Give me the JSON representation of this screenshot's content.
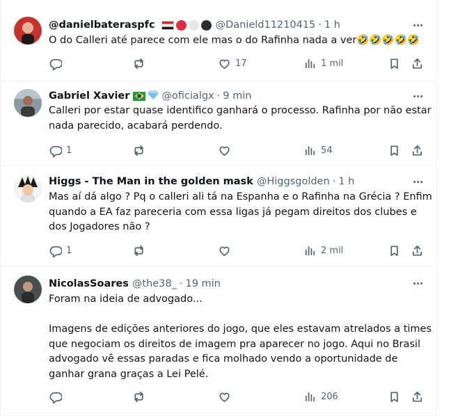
{
  "tweets": [
    {
      "name": "@danielbateraspfc",
      "badges": "eg-flag, red-circle, white-circle, black-circle",
      "handle": "@Danield11210415",
      "time": "1 h",
      "text": "O do Calleri até parece com ele mas o do Rafinha nada a ver🤣🤣🤣🤣🤣",
      "replies": "",
      "reposts": "",
      "likes": "17",
      "views": "1 mil"
    },
    {
      "name": "Gabriel Xavier",
      "badges": "br-flag, gem",
      "handle": "@oficialgx",
      "time": "9 min",
      "text": "Calleri por estar quase identifico ganhará o processo. Rafinha por não estar nada parecido, acabará perdendo.",
      "replies": "1",
      "reposts": "",
      "likes": "",
      "views": "54"
    },
    {
      "name": "Higgs - The Man in the golden mask",
      "badges": "",
      "handle": "@Higgsgolden",
      "time": "1 h",
      "text": "Mas aí dá algo ? Pq o calleri ali tá na Espanha e o Rafinha na Grécia ? Enfim quando a EA faz pareceria com essa ligas já pegam direitos dos clubes e dos Jogadores não ?",
      "replies": "1",
      "reposts": "",
      "likes": "",
      "views": "2 mil"
    },
    {
      "name": "NicolasSoares",
      "badges": "",
      "handle": "@the38_",
      "time": "19 min",
      "text": "Foram na ideia de advogado...\n\nImagens de edições anteriores do jogo, que eles estavam atrelados a times que negociam os direitos de imagem pra aparecer no jogo. Aqui no Brasil advogado vê essas paradas e fica molhado vendo a oportunidade de ganhar grana graças a Lei Pelé.",
      "replies": "",
      "reposts": "",
      "likes": "",
      "views": "206"
    }
  ],
  "colors": {
    "text": "#0f1419",
    "secondary": "#536471",
    "border": "#eff3f4"
  },
  "icons": [
    "reply-icon",
    "repost-icon",
    "like-icon",
    "views-icon",
    "bookmark-icon",
    "share-icon",
    "more-icon"
  ]
}
